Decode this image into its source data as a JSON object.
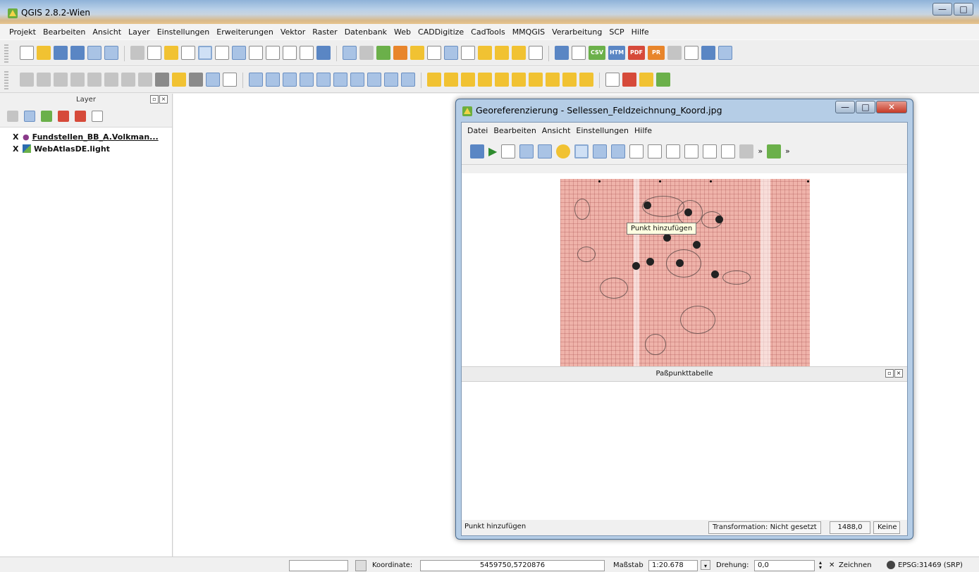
{
  "window": {
    "title": "QGIS 2.8.2-Wien",
    "minimize": "—",
    "maximize": "□"
  },
  "menubar": [
    "Projekt",
    "Bearbeiten",
    "Ansicht",
    "Layer",
    "Einstellungen",
    "Erweiterungen",
    "Vektor",
    "Raster",
    "Datenbank",
    "Web",
    "CADDigitize",
    "CadTools",
    "MMQGIS",
    "Verarbeitung",
    "SCP",
    "Hilfe"
  ],
  "toolbar_badges": {
    "csv": "CSV",
    "htm": "HTM",
    "pdf": "PDF",
    "pr": "PR"
  },
  "layers_panel": {
    "title": "Layer",
    "layers": [
      {
        "name": "Fundstellen_BB_A.Volkman...",
        "checked": "X"
      },
      {
        "name": "WebAtlasDE.light",
        "checked": "X"
      }
    ]
  },
  "georef": {
    "title": "Georeferenzierung - Sellessen_Feldzeichnung_Koord.jpg",
    "menu": [
      "Datei",
      "Bearbeiten",
      "Ansicht",
      "Einstellungen",
      "Hilfe"
    ],
    "tooltip": "Punkt hinzufügen",
    "gcp_table_title": "Paßpunkttabelle",
    "status_left": "Punkt hinzufügen",
    "transformation": "Transformation: Nicht gesetzt",
    "value": "1488,0",
    "none": "Keine",
    "overflow": "»"
  },
  "statusbar": {
    "coordinate_label": "Koordinate:",
    "coordinate_value": "5459750,5720876",
    "scale_label": "Maßstab",
    "scale_value": "1:20.678",
    "rotation_label": "Drehung:",
    "rotation_value": "0,0",
    "render_label": "Zeichnen",
    "crs": "EPSG:31469 (SRP)"
  }
}
